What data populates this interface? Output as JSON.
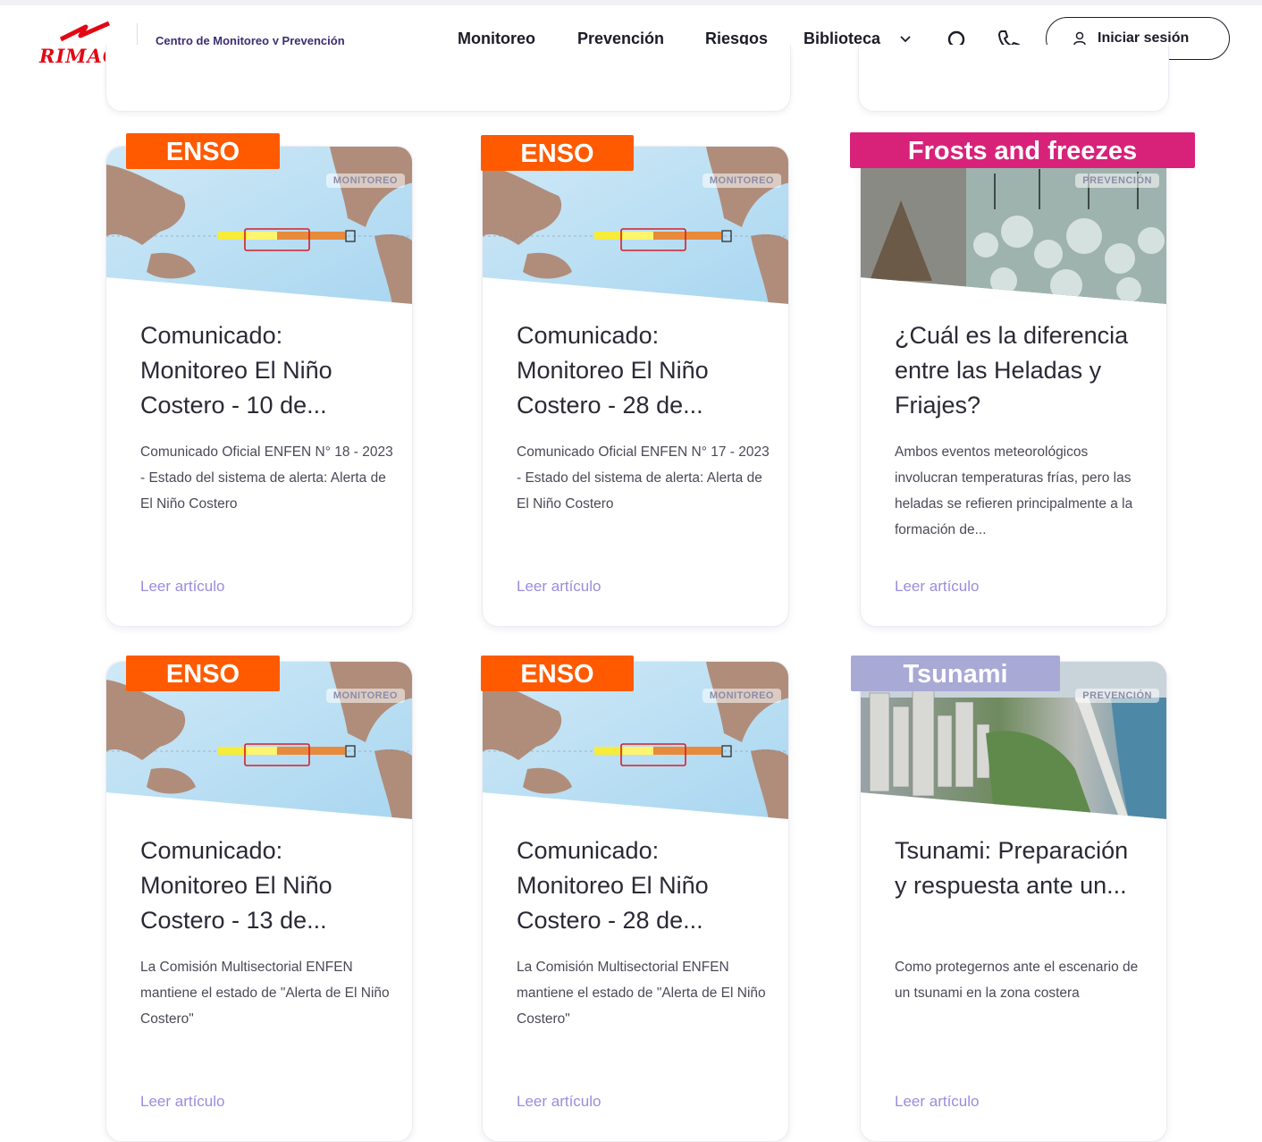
{
  "header": {
    "logo_text": "RIMAC",
    "site_title": "Centro de Monitoreo y Prevención",
    "nav": [
      "Monitoreo",
      "Prevención",
      "Riesgos",
      "Biblioteca"
    ],
    "login_label": "Iniciar sesión"
  },
  "colors": {
    "brand_red": "#e30613",
    "tag_enso": "#ff5a00",
    "tag_frost": "#d8227a",
    "tag_tsunami": "#a9a9d6",
    "link": "#9c8cdc"
  },
  "cards": [
    {
      "tag": "ENSO",
      "badge": "MONITOREO",
      "image": "enso-map",
      "title": "Comunicado: Monitoreo El Niño Costero - 10 de...",
      "desc": "Comunicado Oficial ENFEN N° 18 - 2023 - Estado del sistema de alerta: Alerta de El Niño Costero",
      "link": "Leer artículo"
    },
    {
      "tag": "ENSO",
      "badge": "MONITOREO",
      "image": "enso-map",
      "title": "Comunicado: Monitoreo El Niño Costero - 28 de...",
      "desc": "Comunicado Oficial ENFEN N° 17 - 2023 - Estado del sistema de alerta: Alerta de El Niño Costero",
      "link": "Leer artículo"
    },
    {
      "tag": "Frosts and freezes",
      "badge": "PREVENCIÓN",
      "image": "frost-photo",
      "title": "¿Cuál es la diferencia entre las Heladas y Friajes?",
      "desc": "Ambos eventos meteorológicos involucran temperaturas frías, pero las heladas se refieren principalmente a la formación de...",
      "link": "Leer artículo"
    },
    {
      "tag": "ENSO",
      "badge": "MONITOREO",
      "image": "enso-map",
      "title": "Comunicado: Monitoreo El Niño Costero - 13 de...",
      "desc": "La Comisión Multisectorial ENFEN mantiene el estado de \"Alerta de El Niño Costero\"",
      "link": "Leer artículo"
    },
    {
      "tag": "ENSO",
      "badge": "MONITOREO",
      "image": "enso-map",
      "title": "Comunicado: Monitoreo El Niño Costero - 28 de...",
      "desc": "La Comisión Multisectorial ENFEN mantiene el estado de \"Alerta de El Niño Costero\"",
      "link": "Leer artículo"
    },
    {
      "tag": "Tsunami",
      "badge": "PREVENCIÓN",
      "image": "coast-photo",
      "title": "Tsunami: Preparación y respuesta ante un...",
      "desc": "Como protegernos ante el escenario de un tsunami en la zona costera",
      "link": "Leer artículo"
    }
  ]
}
